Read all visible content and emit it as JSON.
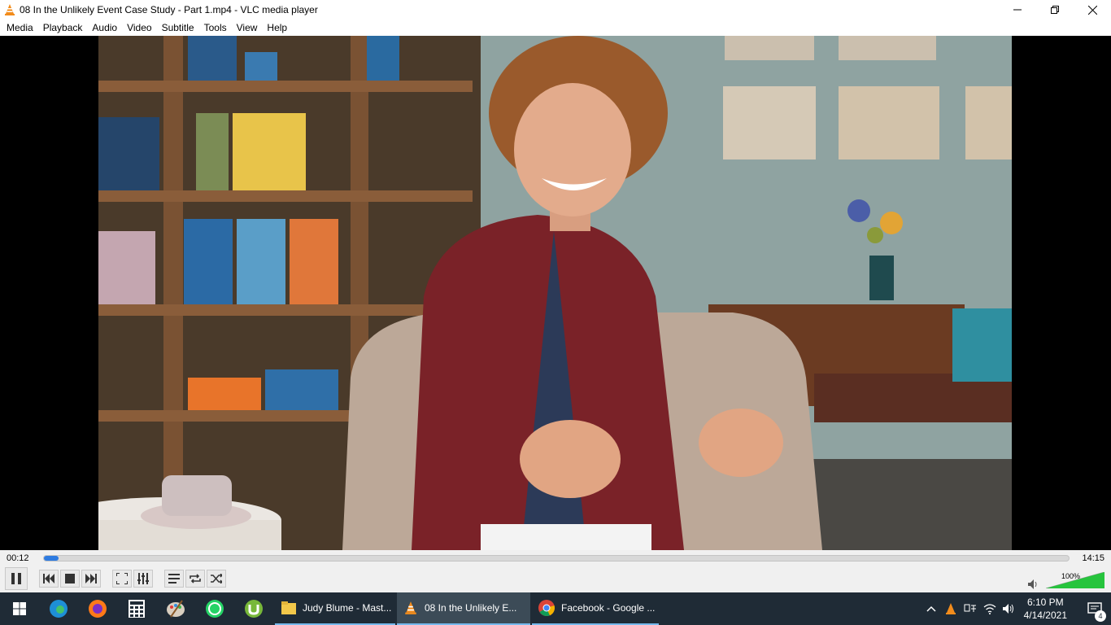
{
  "window": {
    "title": "08 In the Unlikely Event Case Study - Part 1.mp4 - VLC media player"
  },
  "menu": [
    "Media",
    "Playback",
    "Audio",
    "Video",
    "Subtitle",
    "Tools",
    "View",
    "Help"
  ],
  "player": {
    "current_time": "00:12",
    "total_time": "14:15",
    "progress": 0.014,
    "volume_label": "100%",
    "volume_level": 1.0,
    "accent_color": "#2e7be0"
  },
  "taskbar": {
    "pinned": [
      "windows-start-icon",
      "edge-icon",
      "firefox-icon",
      "calculator-icon",
      "paint-icon",
      "whatsapp-icon",
      "utorrent-icon"
    ],
    "tasks": [
      {
        "label": "Judy Blume - Mast...",
        "icon": "folder-icon"
      },
      {
        "label": "08 In the Unlikely E...",
        "icon": "vlc-icon"
      },
      {
        "label": "Facebook - Google ...",
        "icon": "chrome-icon"
      }
    ],
    "clock_time": "6:10 PM",
    "clock_date": "4/14/2021",
    "notification_count": "4"
  }
}
